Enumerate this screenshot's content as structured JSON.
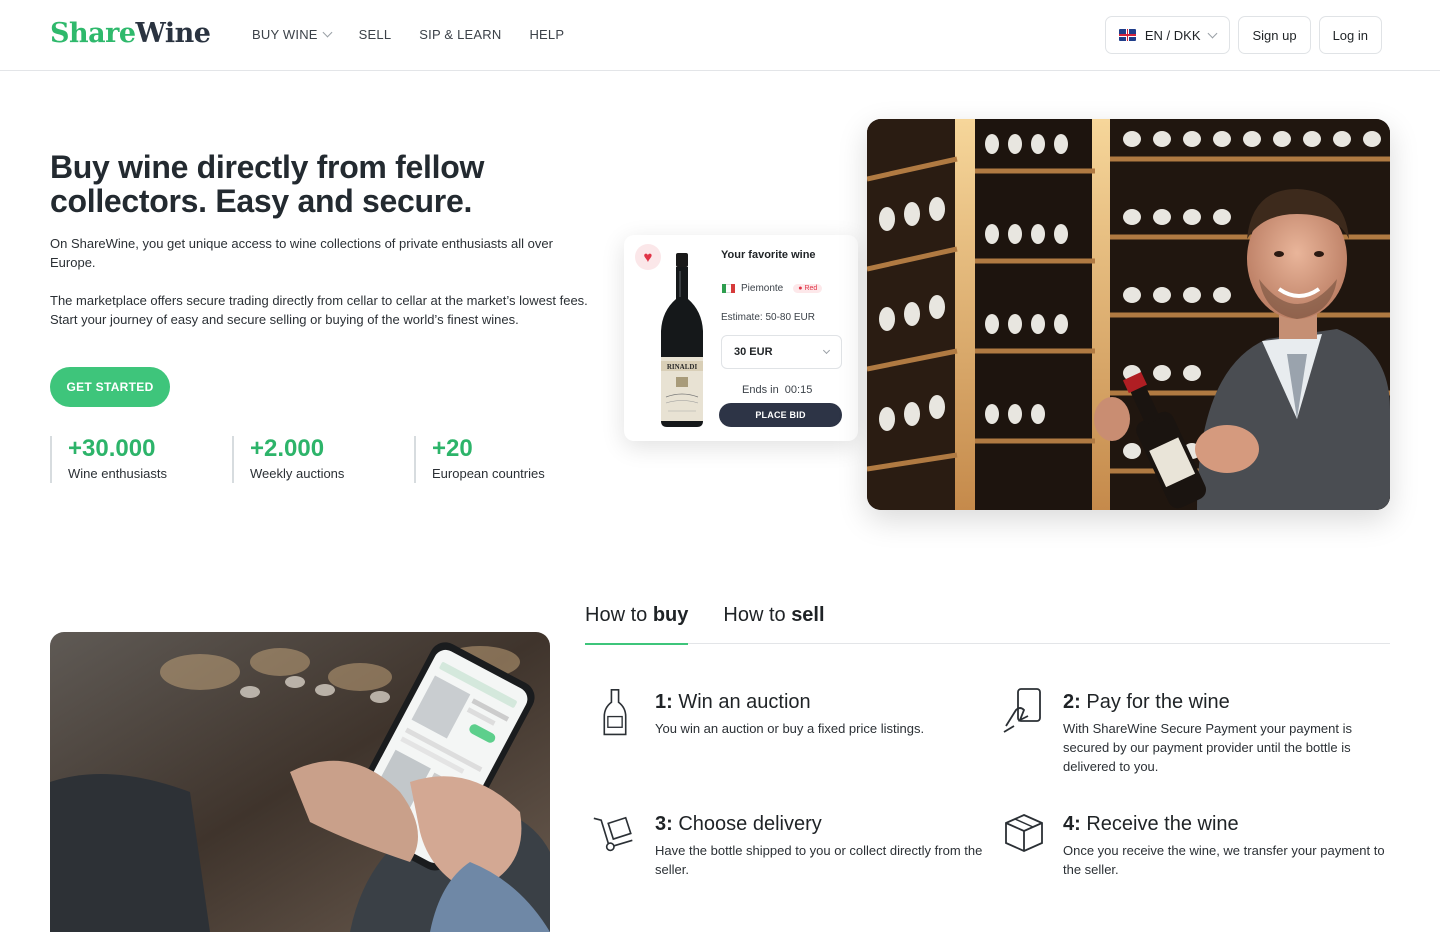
{
  "header": {
    "logo_part1": "Share",
    "logo_part2": "Wine",
    "nav": [
      "BUY WINE",
      "SELL",
      "SIP & LEARN",
      "HELP"
    ],
    "language": "EN / DKK",
    "signup": "Sign up",
    "login": "Log in"
  },
  "hero": {
    "title": "Buy wine directly from fellow collectors. Easy and secure.",
    "p1": "On ShareWine, you get unique access to wine collections of private enthusiasts all over Europe.",
    "p2": "The marketplace offers secure trading directly from cellar to cellar at the market’s lowest fees. Start your journey of easy and secure selling or buying of the world’s finest wines.",
    "cta": "GET STARTED",
    "stats": [
      {
        "value": "+30.000",
        "label": "Wine enthusiasts"
      },
      {
        "value": "+2.000",
        "label": "Weekly auctions"
      },
      {
        "value": "+20",
        "label": "European countries"
      }
    ]
  },
  "card": {
    "title": "Your favorite wine",
    "region": "Piemonte",
    "type_tag": "Red",
    "estimate": "Estimate: 50-80 EUR",
    "bid_value": "30 EUR",
    "ends": "Ends in  00:15",
    "place_bid": "PLACE BID",
    "bottle_label": "RINALDI"
  },
  "howto": {
    "tabs": [
      {
        "prefix": "How to ",
        "bold": "buy"
      },
      {
        "prefix": "How to ",
        "bold": "sell"
      }
    ],
    "steps": [
      {
        "num": "1:",
        "title": " Win an auction",
        "desc": "You win an auction or buy a fixed price listings.",
        "icon": "bottle-icon"
      },
      {
        "num": "2:",
        "title": " Pay for the wine",
        "desc": "With ShareWine Secure Payment your payment is secured by our payment provider until the bottle is delivered to you.",
        "icon": "payment-icon"
      },
      {
        "num": "3:",
        "title": " Choose delivery",
        "desc": "Have the bottle shipped to you or collect directly from the seller.",
        "icon": "hand-truck-icon"
      },
      {
        "num": "4:",
        "title": " Receive the wine",
        "desc": "Once you receive the wine, we transfer your payment to the seller.",
        "icon": "package-icon"
      }
    ]
  },
  "colors": {
    "brand_green": "#3ec57b",
    "dark_navy": "#2d3446"
  }
}
